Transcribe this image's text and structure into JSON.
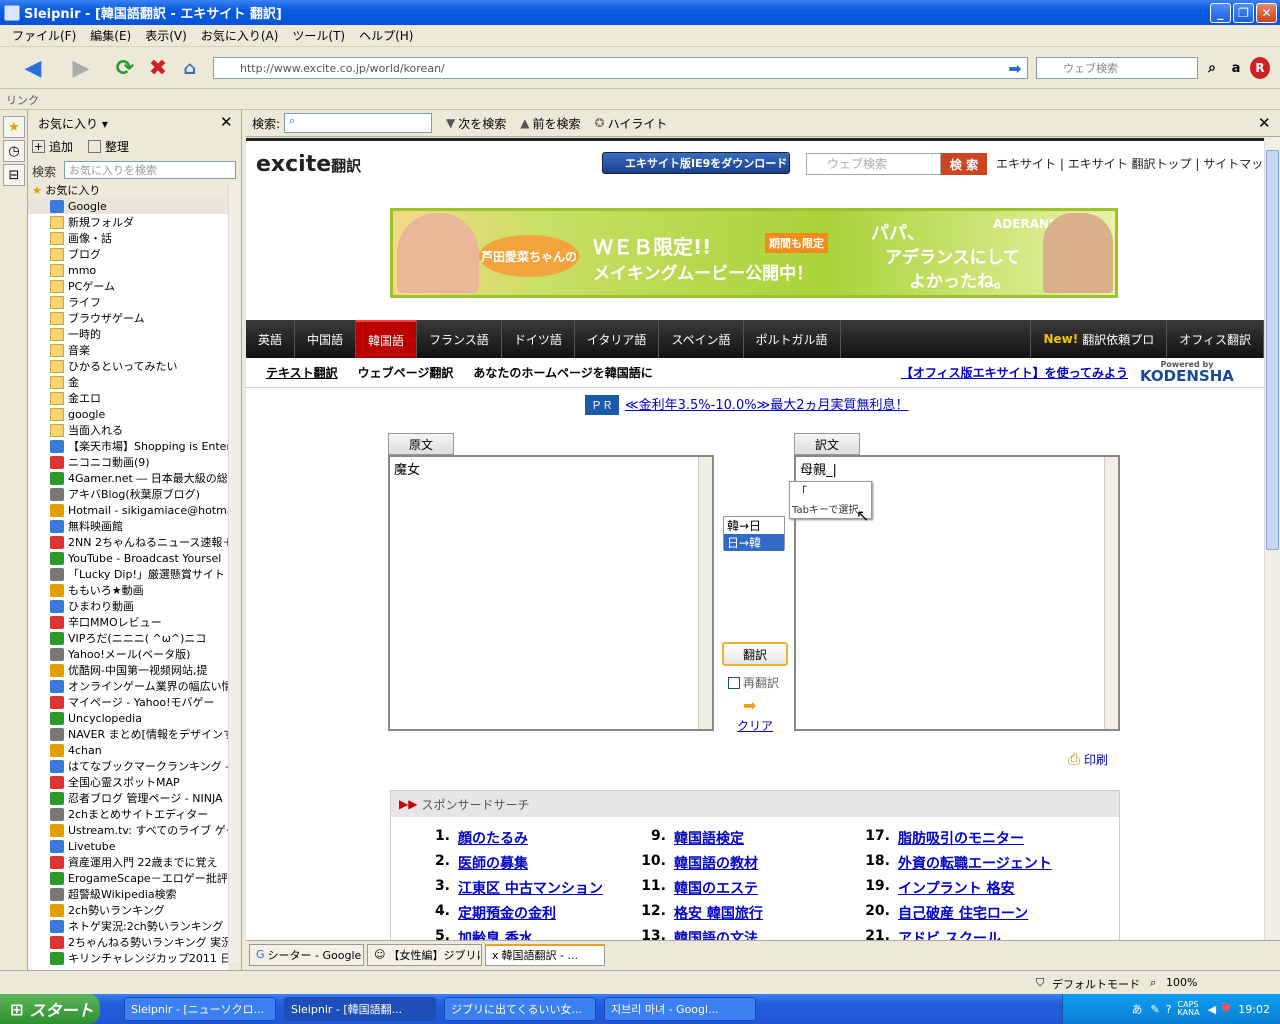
{
  "window": {
    "title": "Sleipnir - [韓国語翻訳 - エキサイト 翻訳]"
  },
  "menu": [
    "ファイル(F)",
    "編集(E)",
    "表示(V)",
    "お気に入り(A)",
    "ツール(T)",
    "ヘルプ(H)"
  ],
  "navbar": {
    "url": "http://www.excite.co.jp/world/korean/",
    "search_placeholder": "ウェブ検索"
  },
  "links_label": "リンク",
  "sidebar": {
    "title": "お気に入り",
    "add_label": "追加",
    "organize_label": "整理",
    "search_label": "検索",
    "search_placeholder": "お気に入りを検索",
    "root": "お気に入り",
    "items": [
      {
        "label": "Google",
        "kind": "site"
      },
      {
        "label": "新規フォルダ",
        "kind": "folder"
      },
      {
        "label": "画像・話",
        "kind": "folder"
      },
      {
        "label": "ブログ",
        "kind": "folder"
      },
      {
        "label": "mmo",
        "kind": "folder"
      },
      {
        "label": "PCゲーム",
        "kind": "folder"
      },
      {
        "label": "ライフ",
        "kind": "folder"
      },
      {
        "label": "ブラウザゲーム",
        "kind": "folder"
      },
      {
        "label": "一時的",
        "kind": "folder"
      },
      {
        "label": "音楽",
        "kind": "folder"
      },
      {
        "label": "ひかるといってみたい",
        "kind": "folder"
      },
      {
        "label": "金",
        "kind": "folder"
      },
      {
        "label": "金エロ",
        "kind": "folder"
      },
      {
        "label": "google",
        "kind": "folder"
      },
      {
        "label": "当面入れる",
        "kind": "folder"
      },
      {
        "label": "【楽天市場】Shopping is Entert",
        "kind": "site"
      },
      {
        "label": "ニコニコ動画(9)",
        "kind": "site"
      },
      {
        "label": "4Gamer.net ― 日本最大級の総",
        "kind": "site"
      },
      {
        "label": "アキバBlog(秋葉原ブログ)",
        "kind": "site"
      },
      {
        "label": "Hotmail - sikigamiace@hotma",
        "kind": "site"
      },
      {
        "label": "無料映画館",
        "kind": "site"
      },
      {
        "label": "2NN 2ちゃんねるニュース速報＋:",
        "kind": "site"
      },
      {
        "label": "YouTube - Broadcast Yoursel",
        "kind": "site"
      },
      {
        "label": "「Lucky Dip!」厳選懸賞サイト",
        "kind": "site"
      },
      {
        "label": "ももいろ★動画",
        "kind": "site"
      },
      {
        "label": "ひまわり動画",
        "kind": "site"
      },
      {
        "label": "辛口MMOレビュー",
        "kind": "site"
      },
      {
        "label": "VIPろだ(ニニニ( ^ω^)ニコ",
        "kind": "site"
      },
      {
        "label": "Yahoo!メール(ベータ版)",
        "kind": "site"
      },
      {
        "label": "优酷网-中国第一视频网站,提",
        "kind": "site"
      },
      {
        "label": "オンラインゲーム業界の幅広い情",
        "kind": "site"
      },
      {
        "label": "マイページ - Yahoo!モバゲー",
        "kind": "site"
      },
      {
        "label": "Uncyclopedia",
        "kind": "site"
      },
      {
        "label": "NAVER まとめ[情報をデザインす",
        "kind": "site"
      },
      {
        "label": "4chan",
        "kind": "site"
      },
      {
        "label": "はてなブックマークランキング - 週",
        "kind": "site"
      },
      {
        "label": "全国心霊スポットMAP",
        "kind": "site"
      },
      {
        "label": "忍者ブログ 管理ページ - NINJA",
        "kind": "site"
      },
      {
        "label": "2chまとめサイトエディター",
        "kind": "site"
      },
      {
        "label": "Ustream.tv: すべてのライブ ゲー",
        "kind": "site"
      },
      {
        "label": "Livetube",
        "kind": "site"
      },
      {
        "label": "資産運用入門 22歳までに覚え",
        "kind": "site"
      },
      {
        "label": "ErogameScape－エロゲー批評",
        "kind": "site"
      },
      {
        "label": "超警級Wikipedia検索",
        "kind": "site"
      },
      {
        "label": "2ch勢いランキング",
        "kind": "site"
      },
      {
        "label": "ネトゲ実況:2ch勢いランキング",
        "kind": "site"
      },
      {
        "label": "2ちゃんねる勢いランキング 実況",
        "kind": "site"
      },
      {
        "label": "キリンチャレンジカップ2011 日本v",
        "kind": "site"
      }
    ]
  },
  "findbar": {
    "label": "検索:",
    "next": "次を検索",
    "prev": "前を検索",
    "highlight": "ハイライト"
  },
  "page": {
    "logo": "excite",
    "logo_suffix": "翻訳",
    "ie9_button": "エキサイト版IE9をダウンロード",
    "search_placeholder": "ウェブ検索",
    "search_button": "検 索",
    "header_links": [
      "エキサイト",
      "エキサイト 翻訳トップ",
      "サイトマップ"
    ],
    "banner": {
      "badge": "芦田愛菜ちゃんの",
      "line1": "ＷＥＢ限定!!",
      "line2": "メイキングムービー公開中！",
      "limited": "期間も限定",
      "right1": "パパ、",
      "right2": "アデランスにして",
      "right3": "よかったね。",
      "brand": "ADERANS"
    },
    "lang_tabs": [
      "英語",
      "中国語",
      "韓国語",
      "フランス語",
      "ドイツ語",
      "イタリア語",
      "スペイン語",
      "ポルトガル語"
    ],
    "new_badge": "New!",
    "pro_link": "翻訳依頼プロ",
    "office_link": "オフィス翻訳",
    "subnav": [
      "テキスト翻訳",
      "ウェブページ翻訳",
      "あなたのホームページを韓国語に"
    ],
    "office_promo": "【オフィス版エキサイト】を使ってみよう",
    "powered_by": "Powered by",
    "kodensha": "KODENSHA",
    "pr_badge": "ＰＲ",
    "pr_text": "≪金利年3.5%-10.0%≫最大2ヵ月実質無利息！",
    "source_tab": "原文",
    "target_tab": "訳文",
    "source_text": "魔女",
    "target_text": "母親_|",
    "ime_char": "「",
    "ime_hint": "Tabキーで選択",
    "dir_options": [
      "韓→日",
      "日→韓"
    ],
    "translate_button": "翻訳",
    "retranslate": "再翻訳",
    "clear": "クリア",
    "print": "印刷",
    "sponsor_title": "スポンサードサーチ",
    "sponsors": [
      {
        "n": "1.",
        "t": "顔のたるみ"
      },
      {
        "n": "2.",
        "t": "医師の募集"
      },
      {
        "n": "3.",
        "t": "江東区 中古マンション"
      },
      {
        "n": "4.",
        "t": "定期預金の金利"
      },
      {
        "n": "5.",
        "t": "加齢臭 香水"
      },
      {
        "n": "9.",
        "t": "韓国語検定"
      },
      {
        "n": "10.",
        "t": "韓国語の教材"
      },
      {
        "n": "11.",
        "t": "韓国のエステ"
      },
      {
        "n": "12.",
        "t": "格安 韓国旅行"
      },
      {
        "n": "13.",
        "t": "韓国語の文法"
      },
      {
        "n": "17.",
        "t": "脂肪吸引のモニター"
      },
      {
        "n": "18.",
        "t": "外資の転職エージェント"
      },
      {
        "n": "19.",
        "t": "インプラント 格安"
      },
      {
        "n": "20.",
        "t": "自己破産 住宅ローン"
      },
      {
        "n": "21.",
        "t": "アドビ スクール"
      }
    ]
  },
  "tabs": [
    "シーター - Google ...",
    "【女性編】ジブリに...",
    "韓国語翻訳 - ..."
  ],
  "status": {
    "mode": "デフォルトモード",
    "zoom": "100%"
  },
  "taskbar": {
    "start": "スタート",
    "tasks": [
      "Sleipnir - [ニューソクロ...",
      "Sleipnir - [韓国語翻...",
      "ジブリに出てくるいい女...",
      "지브리 마녀 - Googl..."
    ],
    "clock": "19:02",
    "caps": "CAPS",
    "kana": "KANA",
    "ime": "あ"
  }
}
